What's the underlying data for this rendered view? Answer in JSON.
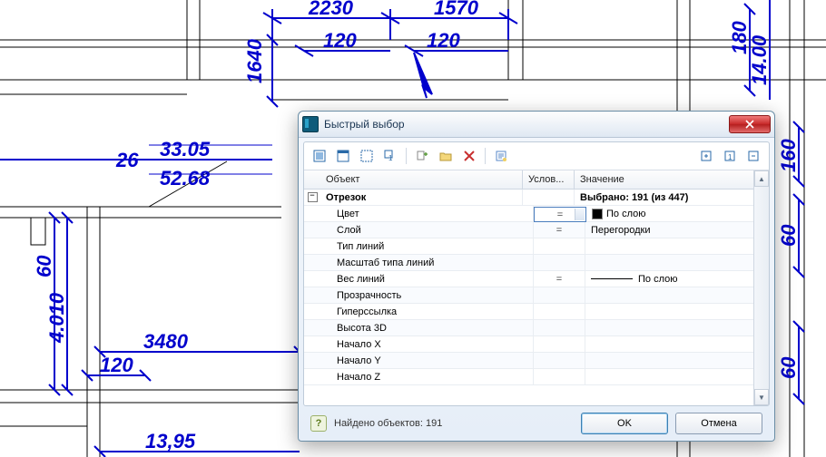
{
  "canvas_dimensions": [
    "2230",
    "1570",
    "120",
    "120",
    "1640",
    "180",
    "14.00",
    "160",
    "60",
    "26",
    "33.05",
    "52.68",
    "60",
    "4.010",
    "3480",
    "120",
    "13,95",
    "60"
  ],
  "dialog": {
    "title": "Быстрый выбор",
    "columns": {
      "object": "Объект",
      "condition": "Услов...",
      "value": "Значение"
    },
    "group": {
      "label": "Отрезок",
      "selected": "Выбрано: 191 (из 447)"
    },
    "rows": [
      {
        "label": "Цвет",
        "cond": "=",
        "value": "По слою",
        "swatch": true,
        "active": true
      },
      {
        "label": "Слой",
        "cond": "=",
        "value": "Перегородки"
      },
      {
        "label": "Тип линий",
        "cond": "",
        "value": ""
      },
      {
        "label": "Масштаб типа линий",
        "cond": "",
        "value": ""
      },
      {
        "label": "Вес линий",
        "cond": "=",
        "value": "По слою",
        "lw": true
      },
      {
        "label": "Прозрачность",
        "cond": "",
        "value": ""
      },
      {
        "label": "Гиперссылка",
        "cond": "",
        "value": ""
      },
      {
        "label": "Высота 3D",
        "cond": "",
        "value": ""
      },
      {
        "label": "Начало X",
        "cond": "",
        "value": ""
      },
      {
        "label": "Начало Y",
        "cond": "",
        "value": ""
      },
      {
        "label": "Начало Z",
        "cond": "",
        "value": ""
      }
    ],
    "status": "Найдено объектов: 191",
    "ok": "OK",
    "cancel": "Отмена"
  },
  "chart_data": null
}
